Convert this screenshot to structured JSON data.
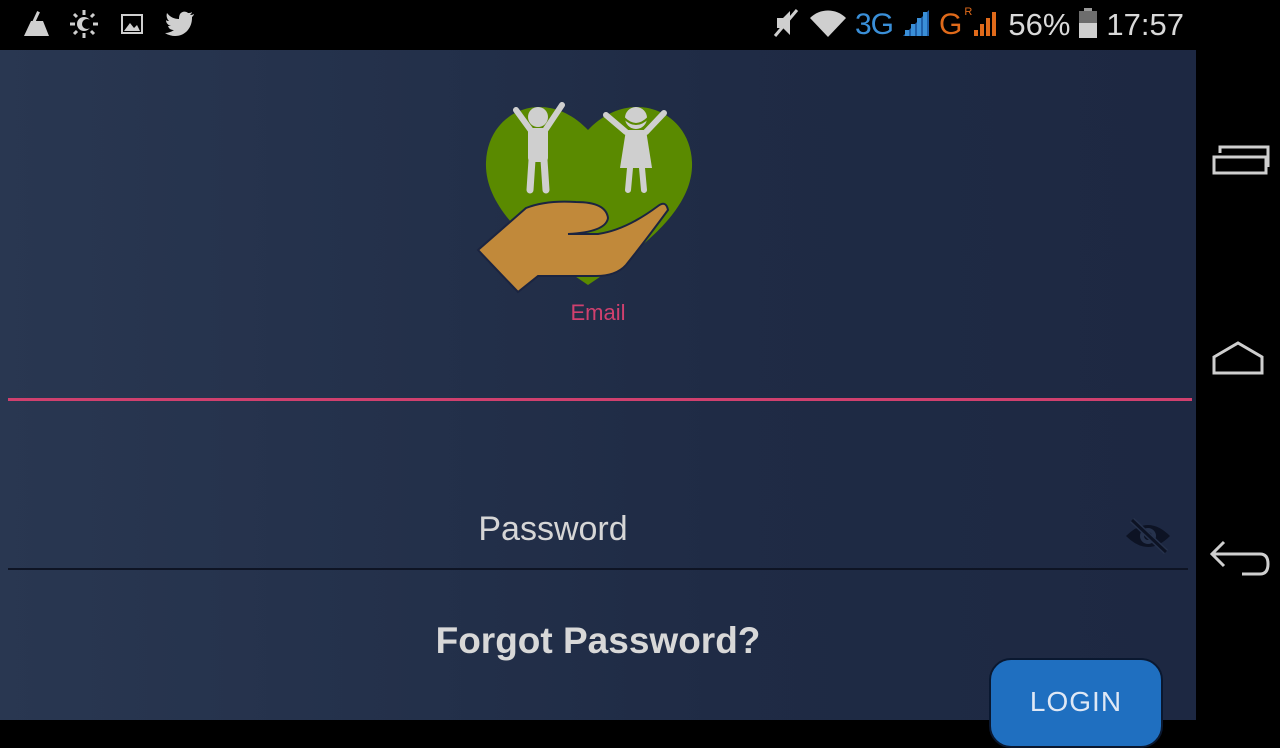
{
  "status_bar": {
    "left_icons": [
      "cleaner-icon",
      "brightness-icon",
      "gallery-icon",
      "twitter-icon"
    ],
    "right_icons": [
      "mute-icon",
      "wifi-icon"
    ],
    "network_3g": "3G",
    "network_g": "G",
    "roaming": "R",
    "battery": "56%",
    "time": "17:57"
  },
  "login": {
    "email_label": "Email",
    "email_value": "",
    "password_placeholder": "Password",
    "forgot_label": "Forgot Password?",
    "login_label": "LOGIN"
  },
  "colors": {
    "accent": "#d0406e",
    "heart": "#5a8a00",
    "hand": "#c1893a",
    "button": "#1f6fc0"
  },
  "nav_bar": {
    "buttons": [
      "recent-apps-icon",
      "home-icon",
      "back-icon"
    ]
  }
}
